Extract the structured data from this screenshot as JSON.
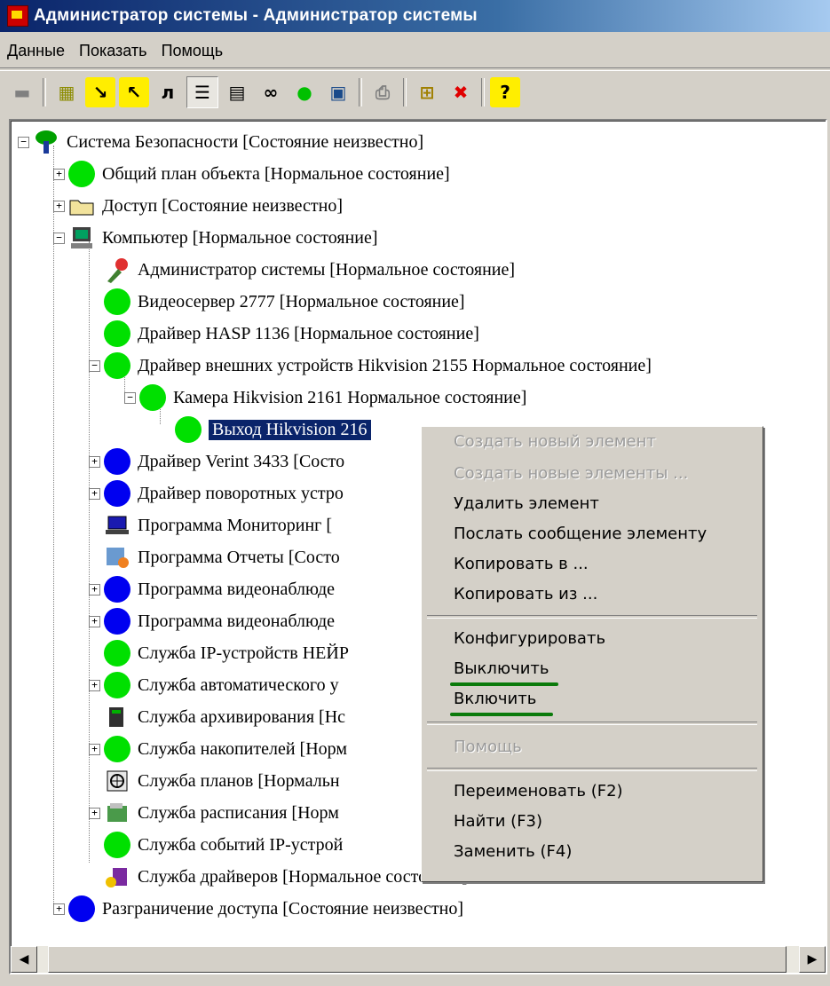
{
  "window": {
    "title": "Администратор системы - Администратор системы"
  },
  "menu": [
    "Данные",
    "Показать",
    "Помощь"
  ],
  "toolbar": {
    "buttons": [
      {
        "icon": "save-icon",
        "glyph": "▬"
      },
      {
        "icon": "grid-dots-icon",
        "glyph": "▦"
      },
      {
        "icon": "arrow-in-icon",
        "glyph": "↘"
      },
      {
        "icon": "arrow-out-icon",
        "glyph": "↖"
      },
      {
        "icon": "letter-l-icon",
        "glyph": "л"
      },
      {
        "icon": "list-details-icon",
        "glyph": "☰"
      },
      {
        "icon": "table-icon",
        "glyph": "▤"
      },
      {
        "icon": "binoculars-icon",
        "glyph": "∞"
      },
      {
        "icon": "start-icon",
        "glyph": "●"
      },
      {
        "icon": "monitor-icon",
        "glyph": "▣"
      },
      {
        "icon": "print-icon",
        "glyph": "⎙"
      },
      {
        "icon": "add-node-icon",
        "glyph": "⊞"
      },
      {
        "icon": "delete-node-icon",
        "glyph": "✖"
      },
      {
        "icon": "help-icon",
        "glyph": "?"
      }
    ]
  },
  "tree": [
    {
      "label": "Система Безопасности [Состояние неизвестно]",
      "icon": "system-tree-icon"
    },
    {
      "label": "Общий план объекта [Нормальное состояние]",
      "icon": "green-circle"
    },
    {
      "label": "Доступ [Состояние неизвестно]",
      "icon": "folder-icon"
    },
    {
      "label": "Компьютер [Нормальное состояние]",
      "icon": "computer-icon"
    },
    {
      "label": "Администратор системы [Нормальное состояние]",
      "icon": "admin-icon"
    },
    {
      "label": "Видеосервер 2777 [Нормальное состояние]",
      "icon": "green-circle"
    },
    {
      "label": "Драйвер HASP 1136 [Нормальное состояние]",
      "icon": "green-circle"
    },
    {
      "label": "Драйвер внешних устройств Hikvision 2155 Нормальное состояние]",
      "icon": "green-circle"
    },
    {
      "label": "Камера Hikvision 2161 Нормальное состояние]",
      "icon": "green-circle"
    },
    {
      "label": "Выход Hikvision 216",
      "icon": "green-circle",
      "selected": true
    },
    {
      "label": "Драйвер Verint 3433 [Состо",
      "icon": "blue-circle"
    },
    {
      "label": "Драйвер поворотных устро",
      "icon": "blue-circle"
    },
    {
      "label": "Программа Мониторинг [",
      "icon": "laptop-icon"
    },
    {
      "label": "Программа Отчеты [Состо",
      "icon": "report-icon"
    },
    {
      "label": "Программа видеонаблюде",
      "icon": "blue-circle"
    },
    {
      "label": "Программа видеонаблюде",
      "icon": "blue-circle"
    },
    {
      "label": "Служба IP-устройств НЕЙР",
      "icon": "green-circle"
    },
    {
      "label": "Служба автоматического у",
      "icon": "green-circle"
    },
    {
      "label": "Служба архивирования [Нс",
      "icon": "archive-icon"
    },
    {
      "label": "Служба накопителей [Норм",
      "icon": "green-circle"
    },
    {
      "label": "Служба планов [Нормальн",
      "icon": "plans-icon"
    },
    {
      "label": "Служба расписания [Норм",
      "icon": "schedule-icon"
    },
    {
      "label": "Служба событий IP-устрой",
      "icon": "green-circle"
    },
    {
      "label": "Служба драйверов [Нормальное состояние]",
      "icon": "drivers-icon"
    },
    {
      "label": "Разграничение доступа [Состояние неизвестно]",
      "icon": "blue-circle"
    }
  ],
  "context_menu": {
    "create_new": "Создать новый элемент",
    "create_many": "Создать новые элементы ...",
    "delete": "Удалить элемент",
    "send_message": "Послать сообщение элементу",
    "copy_to": "Копировать в ...",
    "copy_from": "Копировать из ...",
    "configure": "Конфигурировать",
    "disable": "Выключить",
    "enable": "Включить",
    "help": "Помощь",
    "rename": "Переименовать (F2)",
    "find": "Найти (F3)",
    "replace": "Заменить (F4)"
  }
}
